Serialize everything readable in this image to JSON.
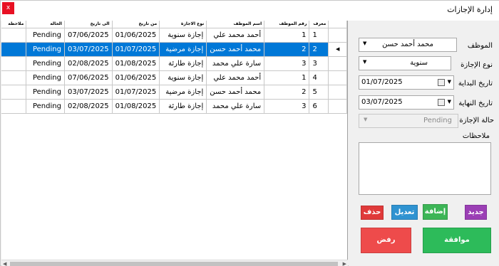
{
  "window": {
    "title": "إدارة الإجازات",
    "close_glyph": "x"
  },
  "grid": {
    "columns": [
      "معرف",
      "رقم الموظف",
      "اسم الموظف",
      "نوع الاجازة",
      "من تاريخ",
      "الى تاريخ",
      "الحالة",
      "ملاحظة"
    ],
    "selected_row_index": 1,
    "row_indicator": "◀",
    "rows": [
      [
        "1",
        "1",
        "أحمد محمد علي",
        "إجازة سنوية",
        "01/06/2025",
        "07/06/2025",
        "Pending",
        ""
      ],
      [
        "2",
        "2",
        "محمد أحمد حسن",
        "إجازة مرضية",
        "01/07/2025",
        "03/07/2025",
        "Pending",
        ""
      ],
      [
        "3",
        "3",
        "سارة علي محمد",
        "إجازة طارئة",
        "01/08/2025",
        "02/08/2025",
        "Pending",
        ""
      ],
      [
        "4",
        "1",
        "أحمد محمد علي",
        "إجازة سنوية",
        "01/06/2025",
        "07/06/2025",
        "Pending",
        ""
      ],
      [
        "5",
        "2",
        "محمد أحمد حسن",
        "إجازة مرضية",
        "01/07/2025",
        "03/07/2025",
        "Pending",
        ""
      ],
      [
        "6",
        "3",
        "سارة علي محمد",
        "إجازة طارئة",
        "01/08/2025",
        "02/08/2025",
        "Pending",
        ""
      ]
    ]
  },
  "form": {
    "employee_label": "الموظف",
    "employee_value": "محمد أحمد حسن",
    "leave_type_label": "نوع الإجازة",
    "leave_type_value": "سنوية",
    "start_date_label": "تاريخ البداية",
    "start_date_value": "01/07/2025",
    "end_date_label": "تاريخ النهاية",
    "end_date_value": "03/07/2025",
    "status_label": "حالة الإجازة",
    "status_value": "Pending",
    "notes_label": "ملاحظات",
    "notes_value": ""
  },
  "buttons": {
    "new": "جديد",
    "add": "إضافة",
    "edit": "تعديل",
    "delete": "حذف",
    "approve": "موافقة",
    "reject": "رفض"
  },
  "colors": {
    "selection": "#0078d7",
    "new": "#9b3fb5",
    "add": "#3cb556",
    "edit": "#2f93d1",
    "delete": "#e03a3a",
    "approve": "#2dbb5a",
    "reject": "#ee4b4b"
  }
}
